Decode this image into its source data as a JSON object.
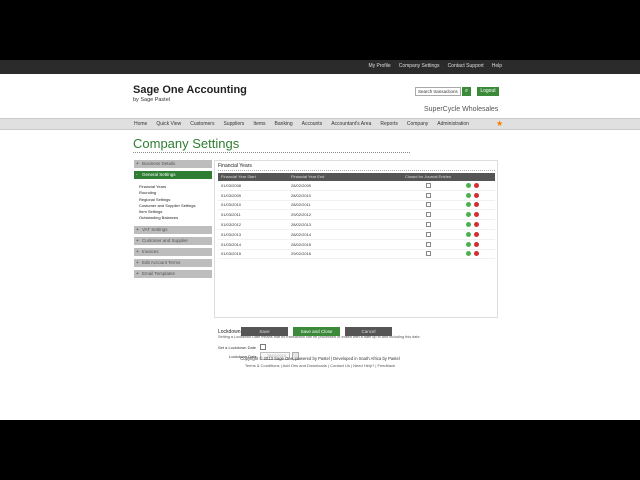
{
  "header": {
    "top_links": [
      "My Profile",
      "Company Settings",
      "Contact Support",
      "Help"
    ],
    "logo_line1": "Sage One Accounting",
    "logo_line2": "by Sage Pastel",
    "search_placeholder": "Search transactions",
    "search_icon": "search-icon",
    "logout_label": "Logout",
    "company_name": "SuperCycle Wholesales"
  },
  "nav": {
    "items": [
      "Home",
      "Quick View",
      "Customers",
      "Suppliers",
      "Items",
      "Banking",
      "Accounts",
      "Accountant's Area",
      "Reports",
      "Company",
      "Administration"
    ],
    "favourite_icon": "star-icon"
  },
  "page_title": "Company Settings",
  "sidebar": {
    "sections": [
      "Business Details",
      "General Settings",
      "VAT Settings",
      "Customer and Supplier",
      "Invoices",
      "Edit Account Terms",
      "Email Templates"
    ],
    "general_sub": [
      "Financial Years",
      "Rounding",
      "Regional Settings",
      "Customer and Supplier Settings",
      "Item Settings",
      "Outstanding Balances"
    ]
  },
  "financial_years": {
    "title": "Financial Years",
    "columns": [
      "Financial Year Start",
      "Financial Year End",
      "Closed for Journal Entries",
      ""
    ],
    "rows": [
      [
        "01/03/2008",
        "28/02/2009"
      ],
      [
        "01/03/2009",
        "28/02/2010"
      ],
      [
        "01/03/2010",
        "28/02/2011"
      ],
      [
        "01/03/2011",
        "29/02/2012"
      ],
      [
        "01/03/2012",
        "28/02/2013"
      ],
      [
        "01/03/2013",
        "28/02/2014"
      ],
      [
        "01/03/2014",
        "28/02/2015"
      ],
      [
        "01/03/2015",
        "29/02/2016"
      ]
    ]
  },
  "lockdown": {
    "title": "Lockdown Date",
    "description": "Setting a Lockdown Date means that no transaction can be processed or edited with a date up to and including this date.",
    "set_label": "Set a Lockdown Date",
    "date_label": "Lockdown Date",
    "date_value": "28/02/2015"
  },
  "buttons": {
    "save": "Save",
    "save_close": "Save and Close",
    "cancel": "Cancel"
  },
  "footer": {
    "line1": "Copyright © 2013 Sage One, powered by Pastel | Developed in South Africa by Pastel",
    "line2": "Terms & Conditions | Add Ons and Downloads | Contact Us | Need Help? | Feedback"
  }
}
